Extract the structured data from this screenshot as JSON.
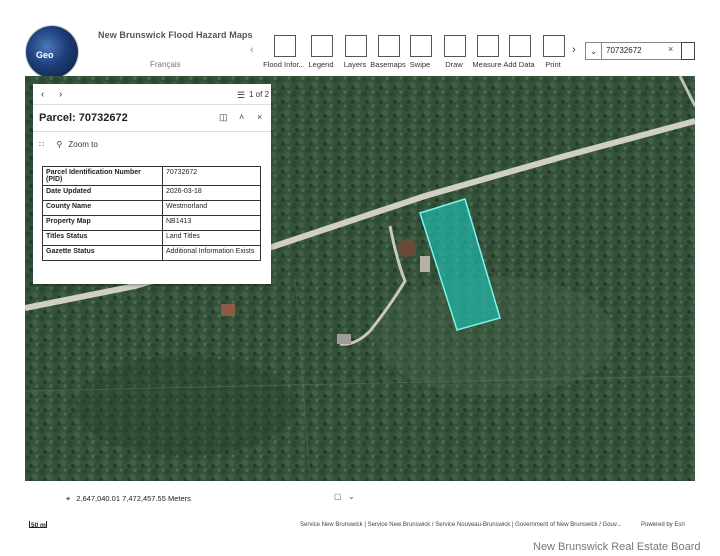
{
  "header": {
    "logo_text": "Geo",
    "app_title": "New Brunswick Flood Hazard Maps",
    "language_link": "Français"
  },
  "toolbar": {
    "tools": [
      {
        "label": "Flood Infor...",
        "icon": "flood-info-icon"
      },
      {
        "label": "Legend",
        "icon": "legend-icon"
      },
      {
        "label": "Layers",
        "icon": "layers-icon"
      },
      {
        "label": "Basemaps",
        "icon": "basemaps-icon"
      },
      {
        "label": "Swipe",
        "icon": "swipe-icon"
      },
      {
        "label": "Draw",
        "icon": "draw-icon"
      },
      {
        "label": "Measure",
        "icon": "measure-icon"
      },
      {
        "label": "Add Data",
        "icon": "add-data-icon"
      },
      {
        "label": "Print",
        "icon": "print-icon"
      }
    ]
  },
  "search": {
    "value": "70732672",
    "clear_glyph": "×"
  },
  "popup": {
    "counter": "1 of 2",
    "title": "Parcel: 70732672",
    "zoom_label": "Zoom to",
    "rows": [
      {
        "key": "Parcel Identification Number (PID)",
        "value": "70732672"
      },
      {
        "key": "Date Updated",
        "value": "2026-03-18"
      },
      {
        "key": "County Name",
        "value": "Westmorland"
      },
      {
        "key": "Property Map",
        "value": "NB1413"
      },
      {
        "key": "Titles Status",
        "value": "Land Titles"
      },
      {
        "key": "Gazette Status",
        "value": "Additional Information Exists"
      }
    ]
  },
  "footer": {
    "coordinates": "2,647,040.01 7,472,457.55 Meters",
    "scale_label": "50 m",
    "attribution": "Service New Brunswick | Service New Brunswick / Service Nouveau-Brunswick | Government of New Brunswick / Gouv...",
    "powered_by": "Powered by Esri"
  },
  "watermark": "New Brunswick Real Estate Board",
  "colors": {
    "parcel_fill": "#1fc0b4",
    "parcel_stroke": "#7ff3ea",
    "forest": "#34513a",
    "road": "#cfcfc6"
  }
}
